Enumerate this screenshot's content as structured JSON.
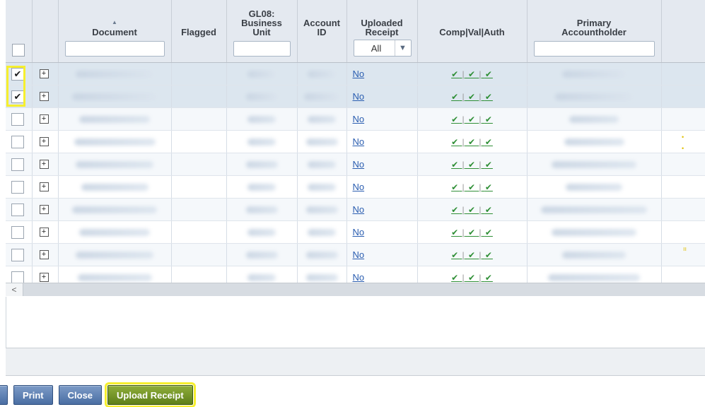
{
  "grid": {
    "columns": {
      "document": "Document",
      "flagged": "Flagged",
      "business_unit": [
        "GL08:",
        "Business",
        "Unit"
      ],
      "account_id": [
        "Account",
        "ID"
      ],
      "uploaded_receipt": [
        "Uploaded",
        "Receipt"
      ],
      "uploaded_receipt_filter": "All",
      "comp_val_auth": "Comp|Val|Auth",
      "primary_accountholder": [
        "Primary",
        "Accountholder"
      ]
    },
    "rows": [
      {
        "checked": true,
        "uploaded_receipt": "No"
      },
      {
        "checked": true,
        "uploaded_receipt": "No"
      },
      {
        "checked": false,
        "uploaded_receipt": "No"
      },
      {
        "checked": false,
        "uploaded_receipt": "No"
      },
      {
        "checked": false,
        "uploaded_receipt": "No"
      },
      {
        "checked": false,
        "uploaded_receipt": "No"
      },
      {
        "checked": false,
        "uploaded_receipt": "No"
      },
      {
        "checked": false,
        "uploaded_receipt": "No"
      },
      {
        "checked": false,
        "uploaded_receipt": "No"
      },
      {
        "checked": false,
        "uploaded_receipt": "No"
      }
    ],
    "expand_symbol": "+",
    "check_symbol": "✔",
    "comp_val_auth_display": [
      "✔",
      "✔",
      "✔"
    ]
  },
  "scrollbar": {
    "left_arrow": "<"
  },
  "buttons": {
    "print": "Print",
    "close": "Close",
    "upload_receipt": "Upload Receipt"
  },
  "colors": {
    "highlight": "#f6ef2e",
    "button_blue": "#4a6ea3",
    "button_green": "#5e7f1a",
    "link": "#2a5db0",
    "check_green": "#2f8f36"
  }
}
